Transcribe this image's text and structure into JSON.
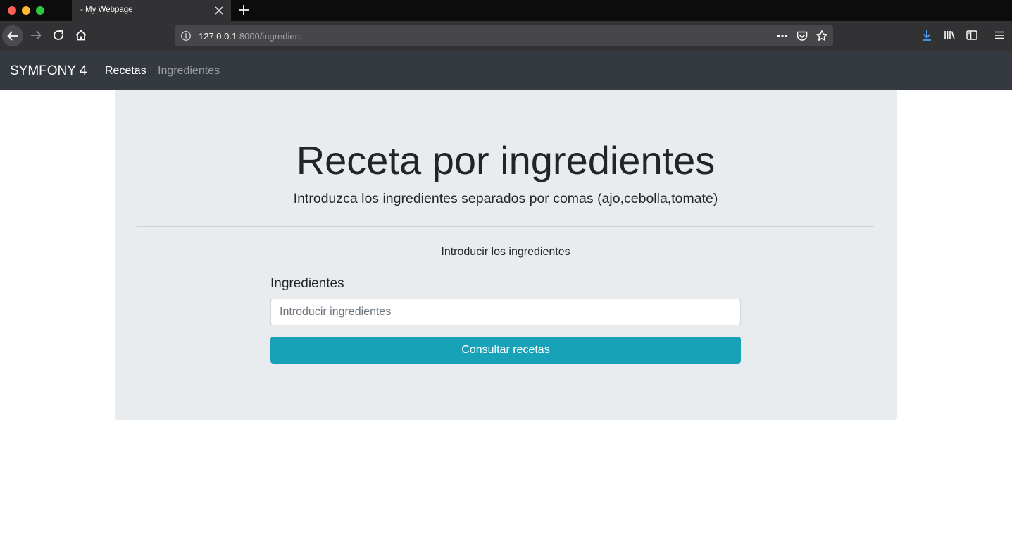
{
  "browser": {
    "tab_title": "- My Webpage",
    "url_host": "127.0.0.1",
    "url_path": ":8000/ingredient",
    "icons": [
      "back-icon",
      "forward-icon",
      "reload-icon",
      "home-icon",
      "info-icon",
      "more-icon",
      "pocket-icon",
      "bookmark-star-icon",
      "download-icon",
      "library-icon",
      "sidebar-icon",
      "menu-icon",
      "close-icon",
      "plus-icon"
    ]
  },
  "navbar": {
    "brand": "SYMFONY 4",
    "links": [
      {
        "label": "Recetas",
        "active": true
      },
      {
        "label": "Ingredientes",
        "active": false
      }
    ]
  },
  "jumbotron": {
    "title": "Receta por ingredientes",
    "lead": "Introduzca los ingredientes separados por comas (ajo,cebolla,tomate)",
    "form_heading": "Introducir los ingredientes",
    "field_label": "Ingredientes",
    "field_placeholder": "Introducir ingredientes",
    "submit_label": "Consultar recetas"
  },
  "colors": {
    "navbar_bg": "#343a40",
    "jumbotron_bg": "#e9ecef",
    "button_bg": "#17a2b8",
    "download_accent": "#45a1ff"
  }
}
